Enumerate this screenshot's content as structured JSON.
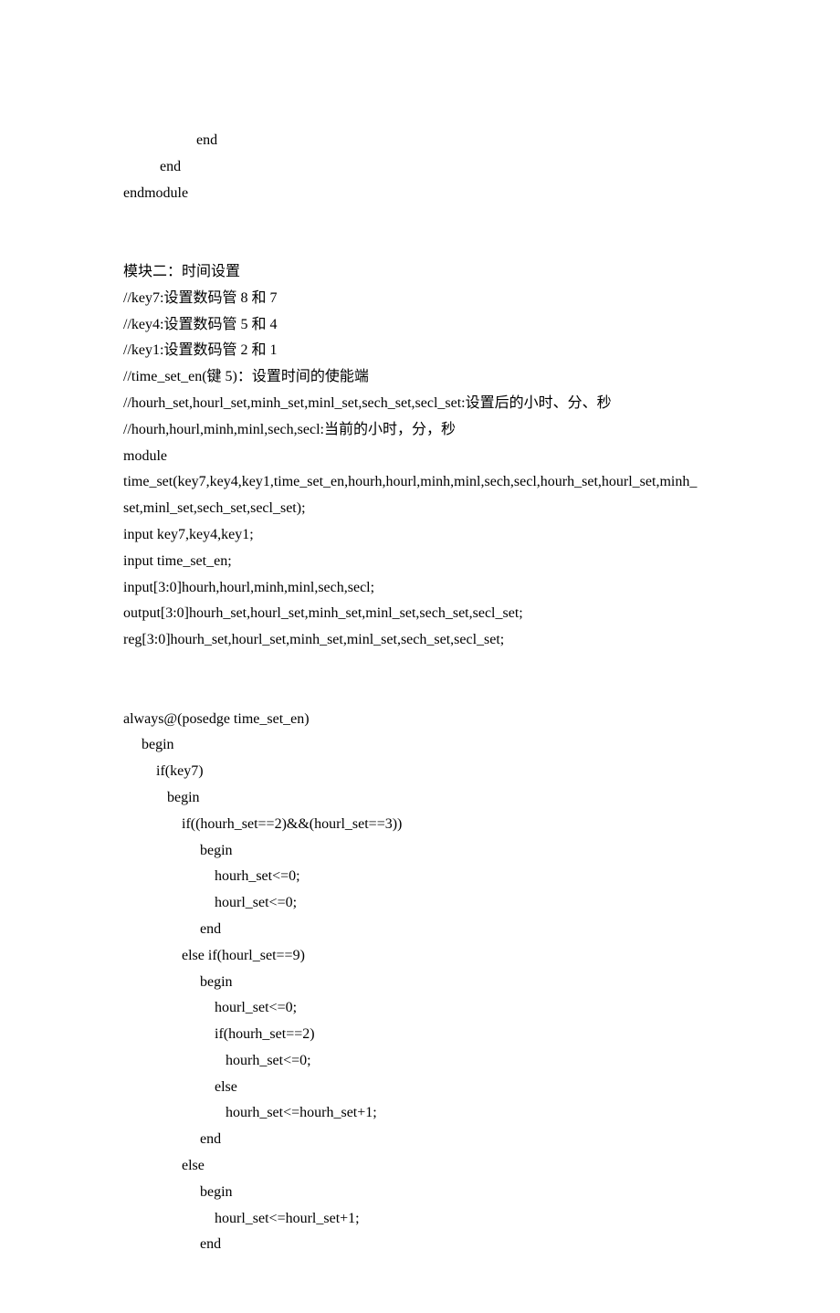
{
  "lines": [
    {
      "text": "                    end",
      "indent": 0
    },
    {
      "text": "          end",
      "indent": 0
    },
    {
      "text": "endmodule",
      "indent": 0
    },
    {
      "blank": true
    },
    {
      "blank": true
    },
    {
      "text": "模块二：时间设置",
      "indent": 0
    },
    {
      "text": "//key7:设置数码管 8 和 7",
      "indent": 0
    },
    {
      "text": "//key4:设置数码管 5 和 4",
      "indent": 0
    },
    {
      "text": "//key1:设置数码管 2 和 1",
      "indent": 0
    },
    {
      "text": "//time_set_en(键 5)：设置时间的使能端",
      "indent": 0
    },
    {
      "text": "//hourh_set,hourl_set,minh_set,minl_set,sech_set,secl_set:设置后的小时、分、秒",
      "indent": 0
    },
    {
      "text": "//hourh,hourl,minh,minl,sech,secl:当前的小时，分，秒",
      "indent": 0
    },
    {
      "text": "module",
      "indent": 0
    },
    {
      "text": "time_set(key7,key4,key1,time_set_en,hourh,hourl,minh,minl,sech,secl,hourh_set,hourl_set,minh_",
      "indent": 0
    },
    {
      "text": "set,minl_set,sech_set,secl_set);",
      "indent": 0
    },
    {
      "text": "input key7,key4,key1;",
      "indent": 0
    },
    {
      "text": "input time_set_en;",
      "indent": 0
    },
    {
      "text": "input[3:0]hourh,hourl,minh,minl,sech,secl;",
      "indent": 0
    },
    {
      "text": "output[3:0]hourh_set,hourl_set,minh_set,minl_set,sech_set,secl_set;",
      "indent": 0
    },
    {
      "text": "reg[3:0]hourh_set,hourl_set,minh_set,minl_set,sech_set,secl_set;",
      "indent": 0
    },
    {
      "blank": true
    },
    {
      "blank": true
    },
    {
      "text": "always@(posedge time_set_en)",
      "indent": 0
    },
    {
      "text": "     begin",
      "indent": 0
    },
    {
      "text": "         if(key7)",
      "indent": 0
    },
    {
      "text": "            begin",
      "indent": 0
    },
    {
      "text": "                if((hourh_set==2)&&(hourl_set==3))",
      "indent": 0
    },
    {
      "text": "                     begin",
      "indent": 0
    },
    {
      "text": "                         hourh_set<=0;",
      "indent": 0
    },
    {
      "text": "                         hourl_set<=0;",
      "indent": 0
    },
    {
      "text": "                     end",
      "indent": 0
    },
    {
      "text": "                else if(hourl_set==9)",
      "indent": 0
    },
    {
      "text": "                     begin",
      "indent": 0
    },
    {
      "text": "                         hourl_set<=0;",
      "indent": 0
    },
    {
      "text": "                         if(hourh_set==2)",
      "indent": 0
    },
    {
      "text": "                            hourh_set<=0;",
      "indent": 0
    },
    {
      "text": "                         else",
      "indent": 0
    },
    {
      "text": "                            hourh_set<=hourh_set+1;",
      "indent": 0
    },
    {
      "text": "                     end",
      "indent": 0
    },
    {
      "text": "                else",
      "indent": 0
    },
    {
      "text": "                     begin",
      "indent": 0
    },
    {
      "text": "                         hourl_set<=hourl_set+1;",
      "indent": 0
    },
    {
      "text": "                     end",
      "indent": 0
    }
  ]
}
